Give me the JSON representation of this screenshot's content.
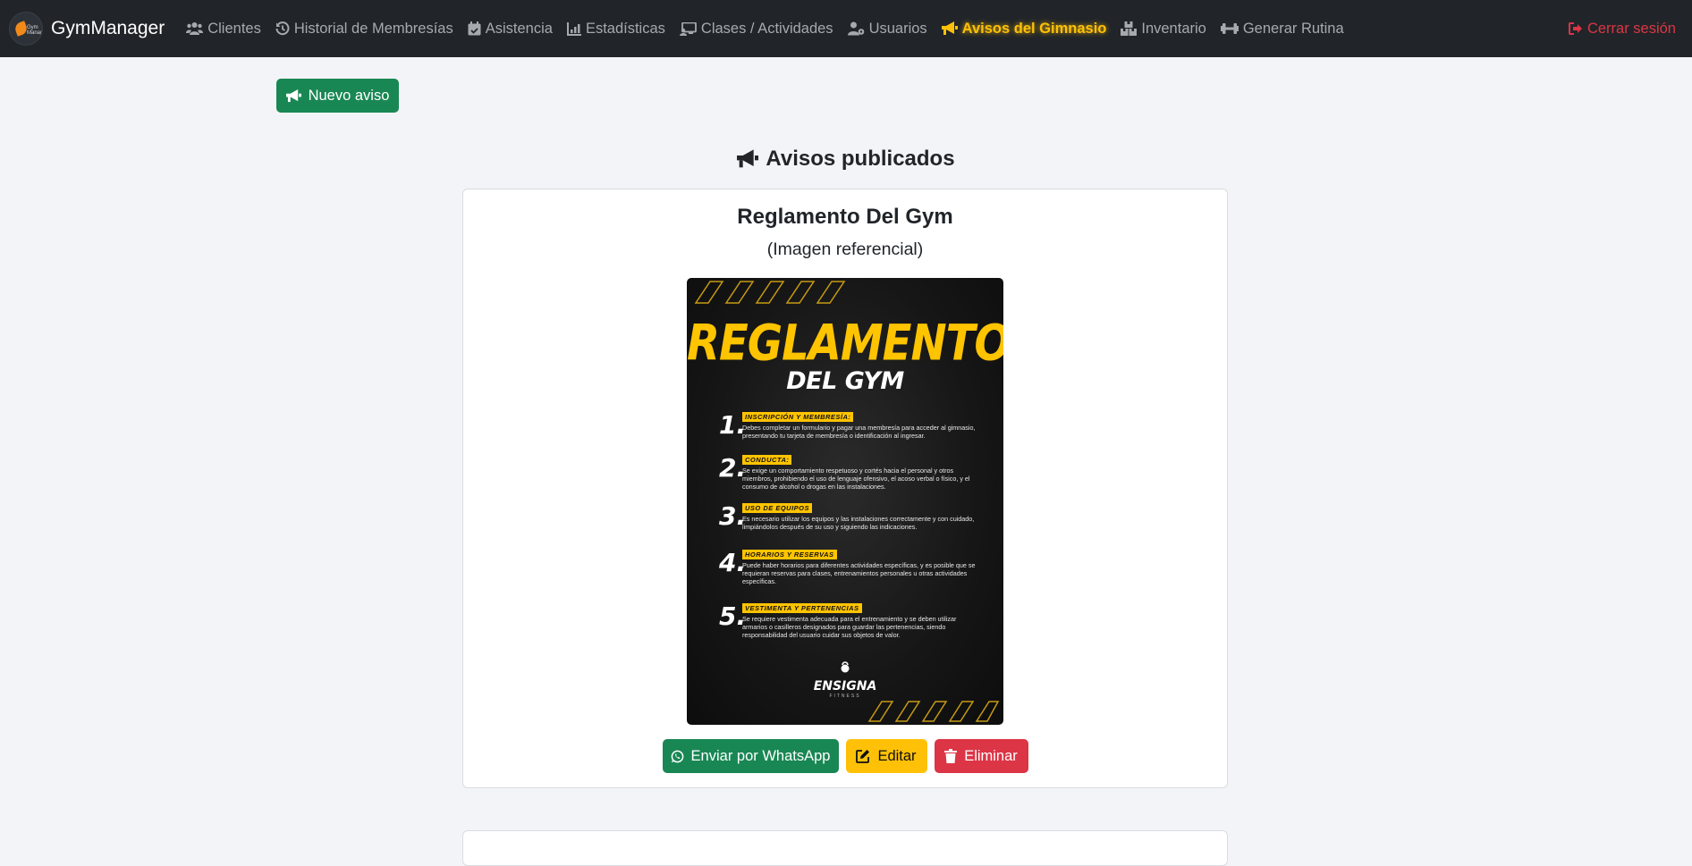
{
  "navbar": {
    "brand": "GymManager",
    "logo_text": "Gym Manager",
    "items": [
      {
        "label": "Clientes",
        "icon": "users-icon"
      },
      {
        "label": "Historial de Membresías",
        "icon": "history-icon"
      },
      {
        "label": "Asistencia",
        "icon": "calendar-check-icon"
      },
      {
        "label": "Estadísticas",
        "icon": "chart-line-icon"
      },
      {
        "label": "Clases / Actividades",
        "icon": "chalkboard-icon"
      },
      {
        "label": "Usuarios",
        "icon": "user-cog-icon"
      },
      {
        "label": "Avisos del Gimnasio",
        "icon": "bullhorn-icon",
        "active": true
      },
      {
        "label": "Inventario",
        "icon": "boxes-icon"
      },
      {
        "label": "Generar Rutina",
        "icon": "dumbbell-icon"
      }
    ],
    "logout": "Cerrar sesión"
  },
  "new_button": "Nuevo aviso",
  "section_title": "Avisos publicados",
  "notice": {
    "title": "Reglamento Del Gym",
    "subtitle": "(Imagen referencial)",
    "poster": {
      "title_line1": "REGLAMENTO",
      "title_line2": "DEL GYM",
      "rules": [
        {
          "num": "1.",
          "heading": "INSCRIPCIÓN Y MEMBRESÍA:",
          "text": "Debes completar un formulario y pagar una membresía para acceder al gimnasio, presentando tu tarjeta de membresía o identificación al ingresar."
        },
        {
          "num": "2.",
          "heading": "CONDUCTA:",
          "text": "Se exige un comportamiento respetuoso y cortés hacia el personal y otros miembros, prohibiendo el uso de lenguaje ofensivo, el acoso verbal o físico, y el consumo de alcohol o drogas en las instalaciones."
        },
        {
          "num": "3.",
          "heading": "USO DE EQUIPOS",
          "text": "Es necesario utilizar los equipos y las instalaciones correctamente y con cuidado, limpiándolos después de su uso y siguiendo las indicaciones."
        },
        {
          "num": "4.",
          "heading": "HORARIOS Y RESERVAS",
          "text": "Puede haber horarios para diferentes actividades específicas, y es posible que se requieran reservas para clases, entrenamientos personales u otras actividades específicas."
        },
        {
          "num": "5.",
          "heading": "VESTIMENTA Y PERTENENCIAS",
          "text": "Se requiere vestimenta adecuada para el entrenamiento y se deben utilizar armarios o casilleros designados para guardar las pertenencias, siendo responsabilidad del usuario cuidar sus objetos de valor."
        }
      ],
      "logo_name": "ENSIGNA",
      "logo_sub": "FITNESS"
    },
    "actions": {
      "whatsapp": "Enviar por WhatsApp",
      "edit": "Editar",
      "delete": "Eliminar"
    }
  },
  "colors": {
    "navbar_bg": "#212529",
    "active_nav": "#ffc107",
    "success": "#198754",
    "warning": "#ffc107",
    "danger": "#dc3545",
    "page_bg": "#f3f4f8"
  }
}
